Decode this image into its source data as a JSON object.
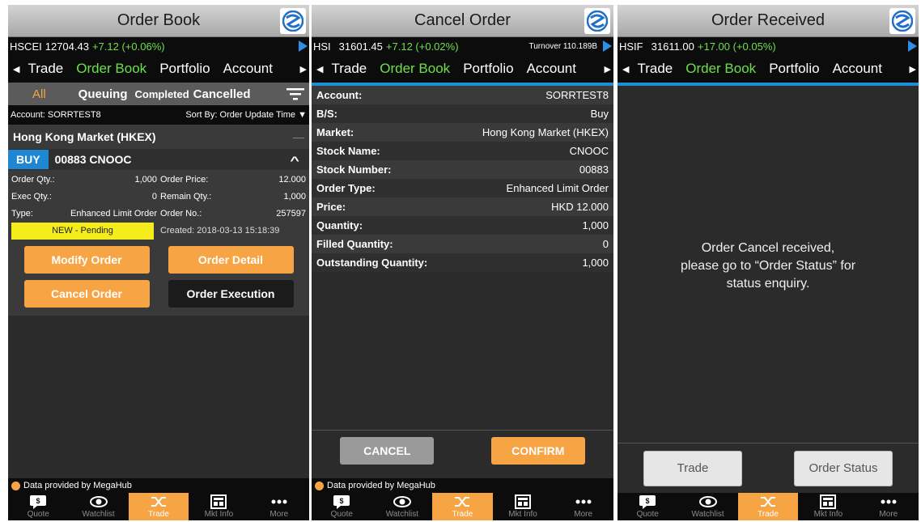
{
  "colors": {
    "accent_orange": "#f7a445",
    "positive_green": "#6ce04a",
    "buy_blue": "#1f86d1",
    "pending_yellow": "#f5ec1c"
  },
  "nav_tabs": [
    "Trade",
    "Order Book",
    "Portfolio",
    "Account"
  ],
  "bottom_nav": [
    {
      "label": "Quote",
      "icon": "quote-icon"
    },
    {
      "label": "Watchlist",
      "icon": "eye-icon"
    },
    {
      "label": "Trade",
      "icon": "trade-icon"
    },
    {
      "label": "Mkt Info",
      "icon": "market-info-icon"
    },
    {
      "label": "More",
      "icon": "more-dots-icon"
    }
  ],
  "footer_note": "Data provided by MegaHub",
  "screen1": {
    "title": "Order Book",
    "ticker": {
      "code": "HSCEI",
      "value": "12704.43",
      "change": "+7.12 (+0.06%)"
    },
    "subtabs": [
      "All",
      "Queuing",
      "Completed",
      "Cancelled"
    ],
    "account_label": "Account: SORRTEST8",
    "sort_label": "Sort By: Order Update Time",
    "market": "Hong Kong Market (HKEX)",
    "market_toggle": "—",
    "order": {
      "side": "BUY",
      "symbol": "00883 CNOOC",
      "rows": [
        {
          "l1": "Order Qty.:",
          "v1": "1,000",
          "l2": "Order Price:",
          "v2": "12.000"
        },
        {
          "l1": "Exec Qty.:",
          "v1": "0",
          "l2": "Remain Qty.:",
          "v2": "1,000"
        },
        {
          "l1": "Type:",
          "v1": "Enhanced Limit Order",
          "l2": "Order No.:",
          "v2": "257597"
        }
      ],
      "status": "NEW - Pending",
      "created": "Created:  2018-03-13 15:18:39"
    },
    "buttons": {
      "modify": "Modify Order",
      "detail": "Order Detail",
      "cancel": "Cancel Order",
      "execution": "Order Execution"
    }
  },
  "screen2": {
    "title": "Cancel Order",
    "ticker": {
      "code": "HSI",
      "value": "31601.45",
      "change": "+7.12 (+0.02%)",
      "turnover": "Turnover 110.189B"
    },
    "details": [
      {
        "label": "Account:",
        "value": "SORRTEST8"
      },
      {
        "label": "B/S:",
        "value": "Buy"
      },
      {
        "label": "Market:",
        "value": "Hong Kong Market (HKEX)"
      },
      {
        "label": "Stock Name:",
        "value": "CNOOC"
      },
      {
        "label": "Stock Number:",
        "value": "00883"
      },
      {
        "label": "Order Type:",
        "value": "Enhanced Limit Order"
      },
      {
        "label": "Price:",
        "value": "HKD 12.000"
      },
      {
        "label": "Quantity:",
        "value": "1,000"
      },
      {
        "label": "Filled Quantity:",
        "value": "0"
      },
      {
        "label": "Outstanding Quantity:",
        "value": "1,000"
      }
    ],
    "cancel_label": "CANCEL",
    "confirm_label": "CONFIRM"
  },
  "screen3": {
    "title": "Order Received",
    "ticker": {
      "code": "HSIF",
      "value": "31611.00",
      "change": "+17.00 (+0.05%)"
    },
    "message": [
      "Order Cancel received,",
      "please go to “Order Status” for",
      "status enquiry."
    ],
    "trade_label": "Trade",
    "status_label": "Order Status"
  }
}
